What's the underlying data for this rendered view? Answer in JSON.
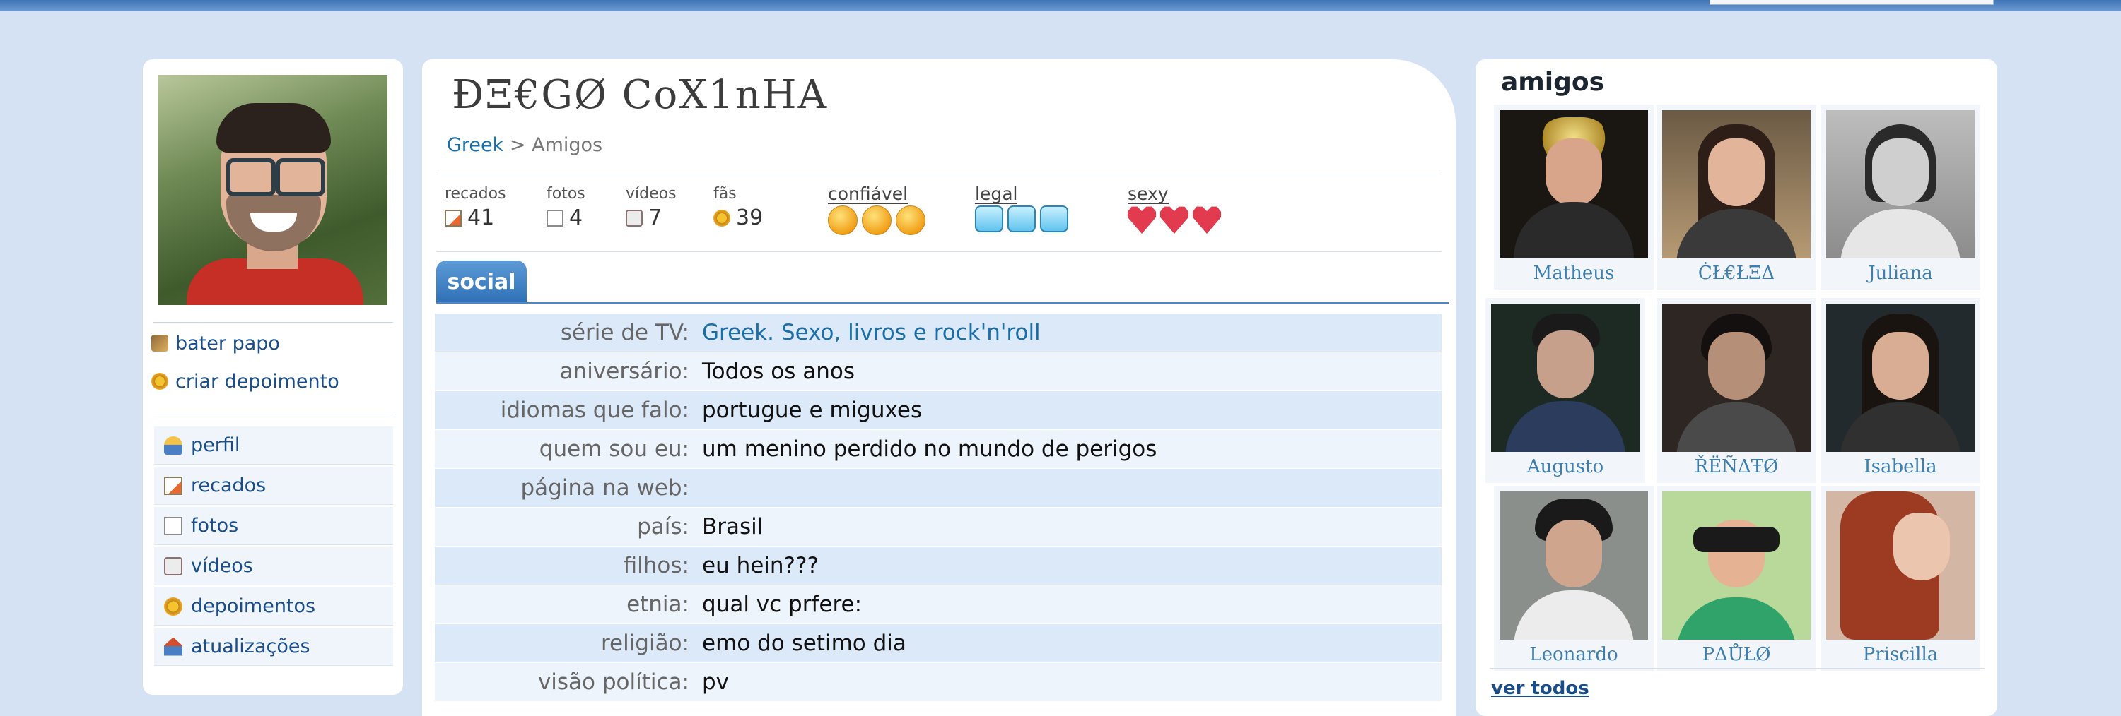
{
  "profile": {
    "name": "ÐΞ€GØ CoX1nHA",
    "breadcrumb": {
      "link": "Greek",
      "separator": ">",
      "current": "Amigos"
    }
  },
  "left": {
    "actions": [
      {
        "label": "bater papo",
        "icon": "chat-icon"
      },
      {
        "label": "criar depoimento",
        "icon": "testimonial-icon"
      }
    ],
    "menu": [
      {
        "label": "perfil",
        "icon": "profile-icon"
      },
      {
        "label": "recados",
        "icon": "scraps-icon"
      },
      {
        "label": "fotos",
        "icon": "photos-icon"
      },
      {
        "label": "vídeos",
        "icon": "videos-icon"
      },
      {
        "label": "depoimentos",
        "icon": "testimonials-icon"
      },
      {
        "label": "atualizações",
        "icon": "updates-icon"
      }
    ]
  },
  "stats": [
    {
      "label": "recados",
      "value": "41",
      "icon": "scraps-icon"
    },
    {
      "label": "fotos",
      "value": "4",
      "icon": "photos-icon"
    },
    {
      "label": "vídeos",
      "value": "7",
      "icon": "videos-icon"
    },
    {
      "label": "fãs",
      "value": "39",
      "icon": "star-icon"
    }
  ],
  "ratings": [
    {
      "label": "confiável",
      "icon": "smiley-icon",
      "level": 3,
      "max": 3
    },
    {
      "label": "legal",
      "icon": "ice-cube-icon",
      "level": 3,
      "max": 3
    },
    {
      "label": "sexy",
      "icon": "heart-icon",
      "level": 3,
      "max": 3
    }
  ],
  "tab": {
    "label": "social"
  },
  "info": [
    {
      "key": "série de TV:",
      "value": "Greek. Sexo, livros e rock'n'roll",
      "link": true
    },
    {
      "key": "aniversário:",
      "value": "Todos os anos"
    },
    {
      "key": "idiomas que falo:",
      "value": "portugue e miguxes"
    },
    {
      "key": "quem sou eu:",
      "value": "um menino perdido no mundo de perigos"
    },
    {
      "key": "página na web:",
      "value": ""
    },
    {
      "key": "país:",
      "value": "Brasil"
    },
    {
      "key": "filhos:",
      "value": "eu hein???"
    },
    {
      "key": "etnia:",
      "value": "qual vc prfere:"
    },
    {
      "key": "religião:",
      "value": "emo do setimo dia"
    },
    {
      "key": "visão política:",
      "value": "pv"
    }
  ],
  "friends": {
    "title": "amigos",
    "see_all": "ver todos",
    "list": [
      {
        "name": "Matheus"
      },
      {
        "name": "ĊŁ€ŁΞΔ"
      },
      {
        "name": "Juliana"
      },
      {
        "name": "Augusto"
      },
      {
        "name": "ŘЁÑΔŦØ"
      },
      {
        "name": "Isabella"
      },
      {
        "name": "Leonardo"
      },
      {
        "name": "PΔŮŁØ"
      },
      {
        "name": "Priscilla"
      }
    ]
  },
  "colors": {
    "background": "#d4e2f3",
    "link": "#1a6fa8",
    "tab": "#3a7ec2",
    "row_odd": "#dce9f8",
    "row_even": "#eef4fc"
  }
}
